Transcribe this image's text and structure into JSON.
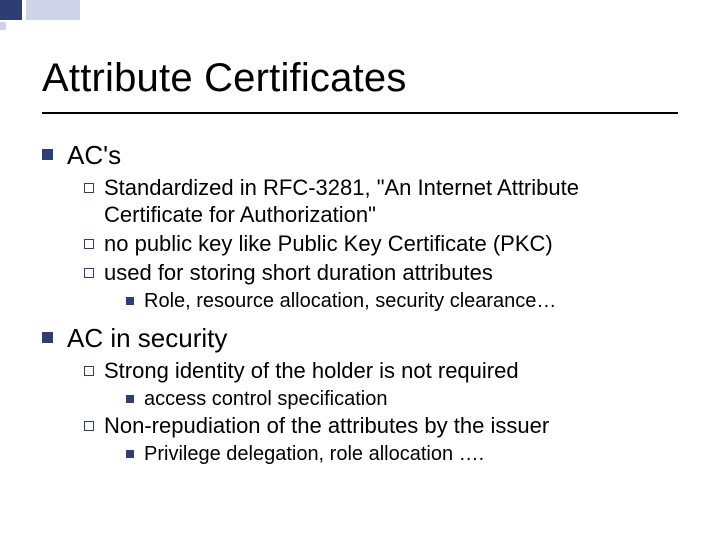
{
  "title": "Attribute Certificates",
  "sections": [
    {
      "heading": "AC's",
      "items": [
        {
          "text": "Standardized in RFC-3281, \"An Internet Attribute Certificate for Authorization\"",
          "sub": []
        },
        {
          "text": "no public key like Public Key Certificate (PKC)",
          "sub": []
        },
        {
          "text": "used for storing short duration attributes",
          "sub": [
            "Role, resource allocation, security clearance…"
          ]
        }
      ]
    },
    {
      "heading": "AC in security",
      "items": [
        {
          "text": "Strong identity of the holder is not required",
          "sub": [
            "access control specification"
          ]
        },
        {
          "text": "Non-repudiation of the attributes by the issuer",
          "sub": [
            "Privilege delegation, role allocation …."
          ]
        }
      ]
    }
  ]
}
